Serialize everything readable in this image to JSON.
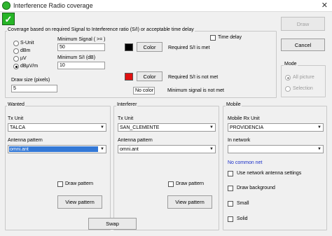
{
  "window": {
    "title": "Interference Radio coverage",
    "close_glyph": "✕"
  },
  "coverage": {
    "group_label": "Coverage based on  required Signal to Interference ratio (S/I) or acceptable time delay",
    "units": [
      {
        "label": "S-Unit",
        "selected": false
      },
      {
        "label": "dBm",
        "selected": false
      },
      {
        "label": "µV",
        "selected": false
      },
      {
        "label": "dBµV/m",
        "selected": true
      }
    ],
    "min_signal_label": "Minimum Signal ( >= )",
    "min_signal_value": "50",
    "min_si_label": "Minimum S/I (dB)",
    "min_si_value": "10",
    "time_delay_label": "Time delay",
    "draw_size_label": "Draw size (pixels)",
    "draw_size_value": "5",
    "color_met": "#000000",
    "color_not_met": "#e01010",
    "color_button_1": "Color",
    "color_button_2": "Color",
    "met_label": "Required S/I is met",
    "not_met_label": "Required S/I is not met",
    "no_color_label": "No color",
    "min_signal_not_met_label": "Minimum signal is not met"
  },
  "buttons": {
    "draw": "Draw",
    "cancel": "Cancel",
    "swap": "Swap"
  },
  "mode": {
    "group_label": "Mode",
    "options": [
      {
        "label": "All picture",
        "selected": true
      },
      {
        "label": "Selection",
        "selected": false
      }
    ]
  },
  "wanted": {
    "group_label": "Wanted",
    "tx_unit_label": "Tx Unit",
    "tx_unit_value": "TALCA",
    "antenna_label": "Antenna pattern",
    "antenna_value": "omni.ant",
    "draw_pattern_label": "Draw pattern",
    "view_pattern_label": "View pattern"
  },
  "interferer": {
    "group_label": "Interferer",
    "tx_unit_label": "Tx Unit",
    "tx_unit_value": "SAN_CLEMENTE",
    "antenna_label": "Antenna pattern",
    "antenna_value": "omni.ant",
    "draw_pattern_label": "Draw pattern",
    "view_pattern_label": "View pattern"
  },
  "mobile": {
    "group_label": "Mobile",
    "rx_unit_label": "Mobile Rx Unit",
    "rx_unit_value": "PROVIDENCIA",
    "network_label": "In network",
    "network_value": "",
    "no_common_net": "No common net",
    "use_network_antenna": "Use network antenna settings",
    "draw_background": "Draw background",
    "small": "Small",
    "solid": "Solid"
  },
  "colors": {
    "accent": "#3378d6",
    "link": "#1a2ec8",
    "app_green": "#26b526"
  }
}
